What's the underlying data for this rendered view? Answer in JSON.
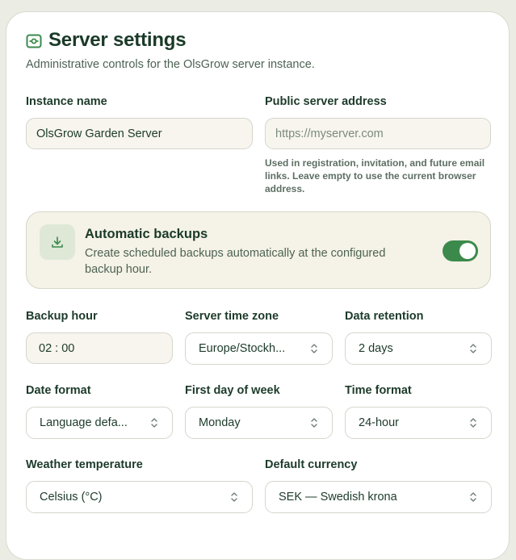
{
  "header": {
    "title": "Server settings",
    "subtitle": "Administrative controls for the OlsGrow server instance.",
    "icon": "server-settings-icon"
  },
  "instance_name": {
    "label": "Instance name",
    "value": "OlsGrow Garden Server"
  },
  "public_address": {
    "label": "Public server address",
    "placeholder": "https://myserver.com",
    "help": "Used in registration, invitation, and future email links. Leave empty to use the current browser address."
  },
  "backups": {
    "title": "Automatic backups",
    "description": "Create scheduled backups automatically at the configured backup hour.",
    "icon": "download-icon",
    "enabled": true
  },
  "backup_hour": {
    "label": "Backup hour",
    "value": "02 : 00"
  },
  "time_zone": {
    "label": "Server time zone",
    "value": "Europe/Stockh..."
  },
  "data_retention": {
    "label": "Data retention",
    "value": "2 days"
  },
  "date_format": {
    "label": "Date format",
    "value": "Language defa..."
  },
  "first_day": {
    "label": "First day of week",
    "value": "Monday"
  },
  "time_format": {
    "label": "Time format",
    "value": "24-hour"
  },
  "weather_temp": {
    "label": "Weather temperature",
    "value": "Celsius (°C)"
  },
  "currency": {
    "label": "Default currency",
    "value": "SEK — Swedish krona"
  },
  "colors": {
    "accent": "#3b8a4c",
    "title": "#1b3a28",
    "background": "#ebece4"
  }
}
